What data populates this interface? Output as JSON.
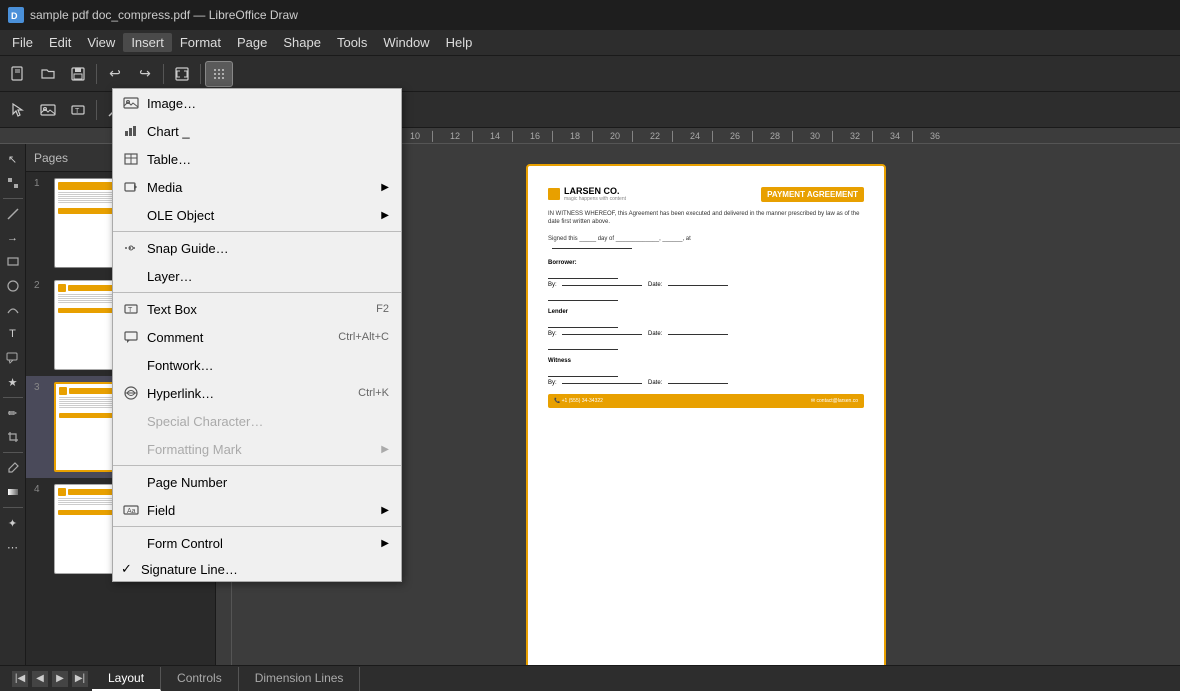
{
  "titlebar": {
    "title": "sample pdf doc_compress.pdf — LibreOffice Draw"
  },
  "menubar": {
    "items": [
      "File",
      "Edit",
      "View",
      "Insert",
      "Format",
      "Page",
      "Shape",
      "Tools",
      "Window",
      "Help"
    ]
  },
  "insert_menu": {
    "items": [
      {
        "id": "image",
        "label": "Image…",
        "icon": "image-icon",
        "shortcut": "",
        "has_arrow": false,
        "disabled": false,
        "has_icon": true
      },
      {
        "id": "chart",
        "label": "Chart _",
        "icon": "chart-icon",
        "shortcut": "",
        "has_arrow": false,
        "disabled": false,
        "has_icon": true
      },
      {
        "id": "table",
        "label": "Table…",
        "icon": "table-icon",
        "shortcut": "",
        "has_arrow": false,
        "disabled": false,
        "has_icon": true
      },
      {
        "id": "media",
        "label": "Media",
        "icon": "media-icon",
        "shortcut": "",
        "has_arrow": true,
        "disabled": false,
        "has_icon": true
      },
      {
        "id": "ole",
        "label": "OLE Object",
        "icon": "",
        "shortcut": "",
        "has_arrow": true,
        "disabled": false,
        "has_icon": false
      },
      {
        "id": "sep1",
        "type": "separator"
      },
      {
        "id": "snap",
        "label": "Snap Guide…",
        "icon": "snap-icon",
        "shortcut": "",
        "has_arrow": false,
        "disabled": false,
        "has_icon": true
      },
      {
        "id": "layer",
        "label": "Layer…",
        "icon": "",
        "shortcut": "",
        "has_arrow": false,
        "disabled": false,
        "has_icon": false
      },
      {
        "id": "sep2",
        "type": "separator"
      },
      {
        "id": "textbox",
        "label": "Text Box",
        "icon": "textbox-icon",
        "shortcut": "F2",
        "has_arrow": false,
        "disabled": false,
        "has_icon": true
      },
      {
        "id": "comment",
        "label": "Comment",
        "icon": "comment-icon",
        "shortcut": "Ctrl+Alt+C",
        "has_arrow": false,
        "disabled": false,
        "has_icon": true
      },
      {
        "id": "fontwork",
        "label": "Fontwork…",
        "icon": "",
        "shortcut": "",
        "has_arrow": false,
        "disabled": false,
        "has_icon": false
      },
      {
        "id": "hyperlink",
        "label": "Hyperlink…",
        "icon": "hyperlink-icon",
        "shortcut": "Ctrl+K",
        "has_arrow": false,
        "disabled": false,
        "has_icon": true
      },
      {
        "id": "special_char",
        "label": "Special Character…",
        "icon": "",
        "shortcut": "",
        "has_arrow": false,
        "disabled": true,
        "has_icon": false
      },
      {
        "id": "format_mark",
        "label": "Formatting Mark",
        "icon": "",
        "shortcut": "",
        "has_arrow": true,
        "disabled": true,
        "has_icon": false
      },
      {
        "id": "sep3",
        "type": "separator"
      },
      {
        "id": "page_num",
        "label": "Page Number",
        "icon": "",
        "shortcut": "",
        "has_arrow": false,
        "disabled": false,
        "has_icon": false
      },
      {
        "id": "field",
        "label": "Field",
        "icon": "field-icon",
        "shortcut": "",
        "has_arrow": true,
        "disabled": false,
        "has_icon": true
      },
      {
        "id": "sep4",
        "type": "separator"
      },
      {
        "id": "form_control",
        "label": "Form Control",
        "icon": "",
        "shortcut": "",
        "has_arrow": true,
        "disabled": false,
        "has_icon": false
      },
      {
        "id": "sig_line",
        "label": "Signature Line…",
        "icon": "",
        "shortcut": "",
        "has_arrow": false,
        "disabled": false,
        "has_icon": false,
        "has_check": true
      }
    ]
  },
  "pages": {
    "label": "Pages",
    "items": [
      {
        "num": "1",
        "active": false
      },
      {
        "num": "2",
        "active": false
      },
      {
        "num": "3",
        "active": true
      },
      {
        "num": "4",
        "active": false
      }
    ]
  },
  "document": {
    "company": "LARSEN CO.",
    "tagline": "magic happens with content",
    "title": "PAYMENT AGREEMENT",
    "body_text": "IN WITNESS WHEREOF, this Agreement has been executed and delivered in the manner prescribed by law as of the date first written above.",
    "signed_line": "Signed this _____ day of _____________, ______, at",
    "borrower_label": "Borrower:",
    "by_label": "By:",
    "date_label": "Date:",
    "lender_label": "Lender",
    "witness_label": "Witness",
    "phone": "+1 (555) 34-34322",
    "email": "contact@larsen.co"
  },
  "statusbar": {
    "tabs": [
      "Layout",
      "Controls",
      "Dimension Lines"
    ],
    "active_tab": "Layout"
  }
}
